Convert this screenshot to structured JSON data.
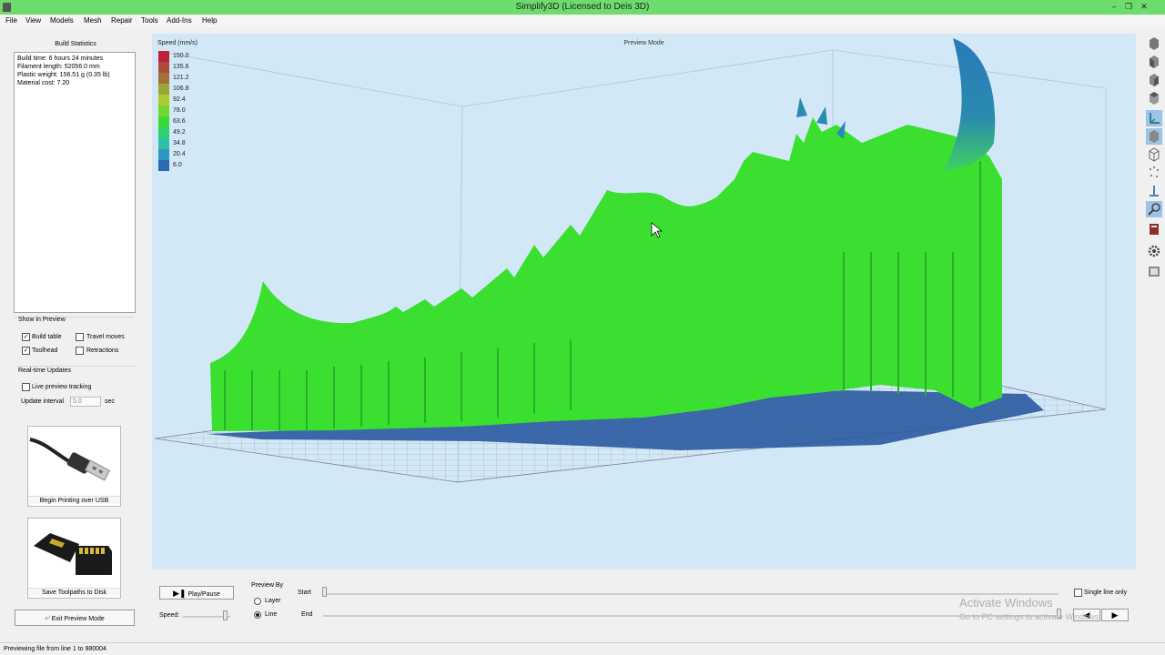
{
  "window": {
    "title": "Simplify3D (Licensed to Deis 3D)"
  },
  "menu": [
    "File",
    "View",
    "Models",
    "Mesh",
    "Repair",
    "Tools",
    "Add-Ins",
    "Help"
  ],
  "left_panel": {
    "build_stats_title": "Build Statistics",
    "stats": [
      "Build time: 6 hours 24 minutes",
      "Filament length: 52056.0 mm",
      "Plastic weight: 156.51 g (0.35 lb)",
      "Material cost: 7.20"
    ],
    "show_in_preview_label": "Show in Preview",
    "options": {
      "build_table": {
        "label": "Build table",
        "checked": true
      },
      "travel_moves": {
        "label": "Travel moves",
        "checked": false
      },
      "toolhead": {
        "label": "Toolhead",
        "checked": true
      },
      "retractions": {
        "label": "Retractions",
        "checked": false
      }
    },
    "realtime_label": "Real-time Updates",
    "live_preview": {
      "label": "Live preview tracking",
      "checked": false
    },
    "update_interval_label": "Update interval",
    "update_interval_value": "5.0",
    "update_interval_unit": "sec",
    "usb_button_label": "Begin Printing over USB",
    "disk_button_label": "Save Toolpaths to Disk",
    "exit_button_label": "Exit Preview Mode"
  },
  "viewport": {
    "mode_label": "Preview Mode",
    "legend_title": "Speed (mm/s)",
    "legend": [
      {
        "value": "150.0",
        "color": "#c0203a"
      },
      {
        "value": "135.6",
        "color": "#b04a3a"
      },
      {
        "value": "121.2",
        "color": "#a4703a"
      },
      {
        "value": "106.8",
        "color": "#98a838"
      },
      {
        "value": "92.4",
        "color": "#a8cc30"
      },
      {
        "value": "78.0",
        "color": "#70d830"
      },
      {
        "value": "63.6",
        "color": "#3ad838"
      },
      {
        "value": "49.2",
        "color": "#30d070"
      },
      {
        "value": "34.8",
        "color": "#30c0a8"
      },
      {
        "value": "20.4",
        "color": "#3098c0"
      },
      {
        "value": "6.0",
        "color": "#2a6ab0"
      }
    ]
  },
  "bottom_bar": {
    "play_pause_label": "Play/Pause",
    "speed_label": "Speed:",
    "preview_by_label": "Preview By",
    "layer_label": "Layer",
    "line_label": "Line",
    "preview_by_selected": "Line",
    "start_label": "Start",
    "end_label": "End",
    "single_line_label": "Single line only",
    "single_line_checked": false,
    "activate_title": "Activate Windows",
    "activate_sub": "Go to PC settings to activate Windows."
  },
  "status": {
    "text": "Previewing file from line 1 to 980004"
  }
}
